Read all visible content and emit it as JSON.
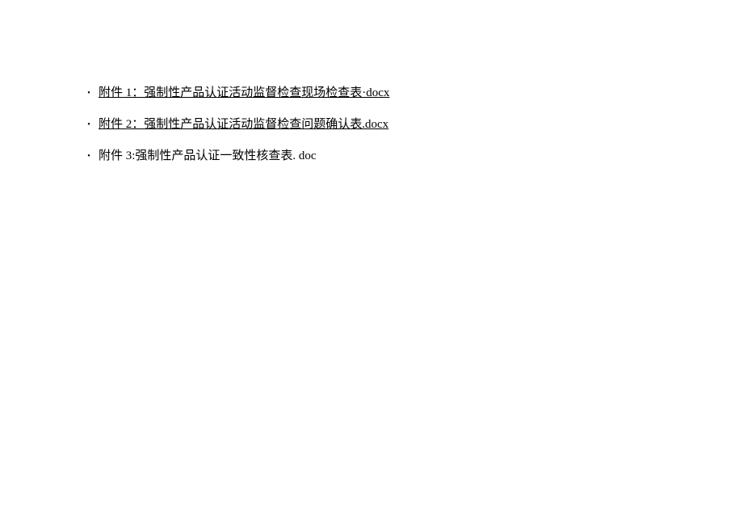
{
  "attachments": [
    {
      "label": "附件 1：强制性产品认证活动监督检查现场检查表·docx",
      "is_link": true
    },
    {
      "label": "附件 2：强制性产品认证活动监督检查问题确认表.docx",
      "is_link": true
    },
    {
      "label": "附件 3:强制性产品认证一致性核查表. doc",
      "is_link": false
    }
  ]
}
